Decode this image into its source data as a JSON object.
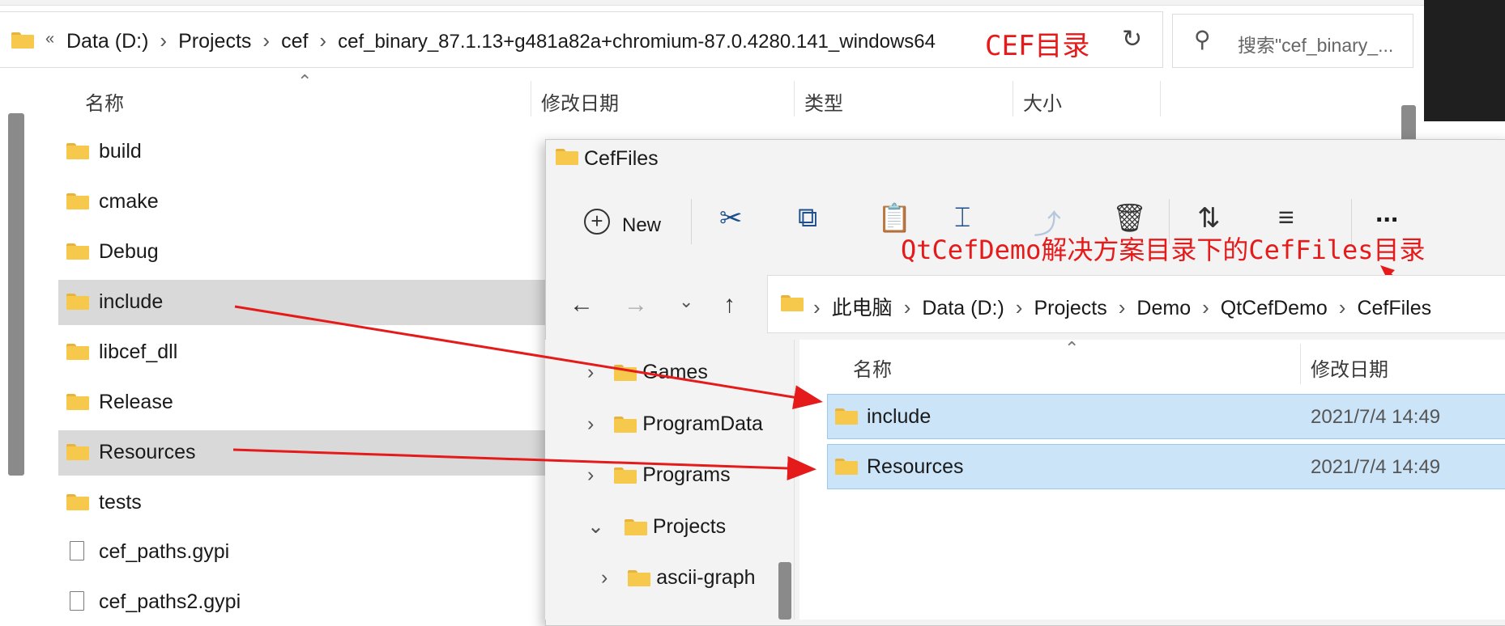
{
  "back_window": {
    "breadcrumb": [
      "Data (D:)",
      "Projects",
      "cef",
      "cef_binary_87.1.13+g481a82a+chromium-87.0.4280.141_windows64"
    ],
    "overflow_glyph": "«",
    "annotation": "CEF目录",
    "search_placeholder": "搜索\"cef_binary_...",
    "columns": {
      "name": "名称",
      "modified": "修改日期",
      "type": "类型",
      "size": "大小"
    },
    "items": [
      {
        "name": "build",
        "icon": "folder-icon"
      },
      {
        "name": "cmake",
        "icon": "folder-icon"
      },
      {
        "name": "Debug",
        "icon": "folder-icon"
      },
      {
        "name": "include",
        "icon": "folder-icon",
        "selected": true
      },
      {
        "name": "libcef_dll",
        "icon": "folder-icon"
      },
      {
        "name": "Release",
        "icon": "folder-icon"
      },
      {
        "name": "Resources",
        "icon": "folder-icon",
        "selected": true
      },
      {
        "name": "tests",
        "icon": "folder-icon"
      },
      {
        "name": "cef_paths.gypi",
        "icon": "file-icon"
      },
      {
        "name": "cef_paths2.gypi",
        "icon": "file-icon"
      }
    ]
  },
  "front_window": {
    "title": "CefFiles",
    "toolbar": {
      "new_label": "New",
      "more": "..."
    },
    "annotation": "QtCefDemo解决方案目录下的CefFiles目录",
    "breadcrumb": [
      "此电脑",
      "Data (D:)",
      "Projects",
      "Demo",
      "QtCefDemo",
      "CefFiles"
    ],
    "nav_tree": [
      {
        "name": "Games",
        "expander": "›"
      },
      {
        "name": "ProgramData",
        "expander": "›"
      },
      {
        "name": "Programs",
        "expander": "›"
      },
      {
        "name": "Projects",
        "expander": "⌄"
      },
      {
        "name": "ascii-graph",
        "expander": "›"
      }
    ],
    "columns": {
      "name": "名称",
      "modified": "修改日期"
    },
    "items": [
      {
        "name": "include",
        "modified": "2021/7/4 14:49"
      },
      {
        "name": "Resources",
        "modified": "2021/7/4 14:49"
      }
    ]
  },
  "colors": {
    "annotation": "#e51a1a",
    "selection_blue": "#cce4f7",
    "selection_grey": "#d9d9d9"
  }
}
